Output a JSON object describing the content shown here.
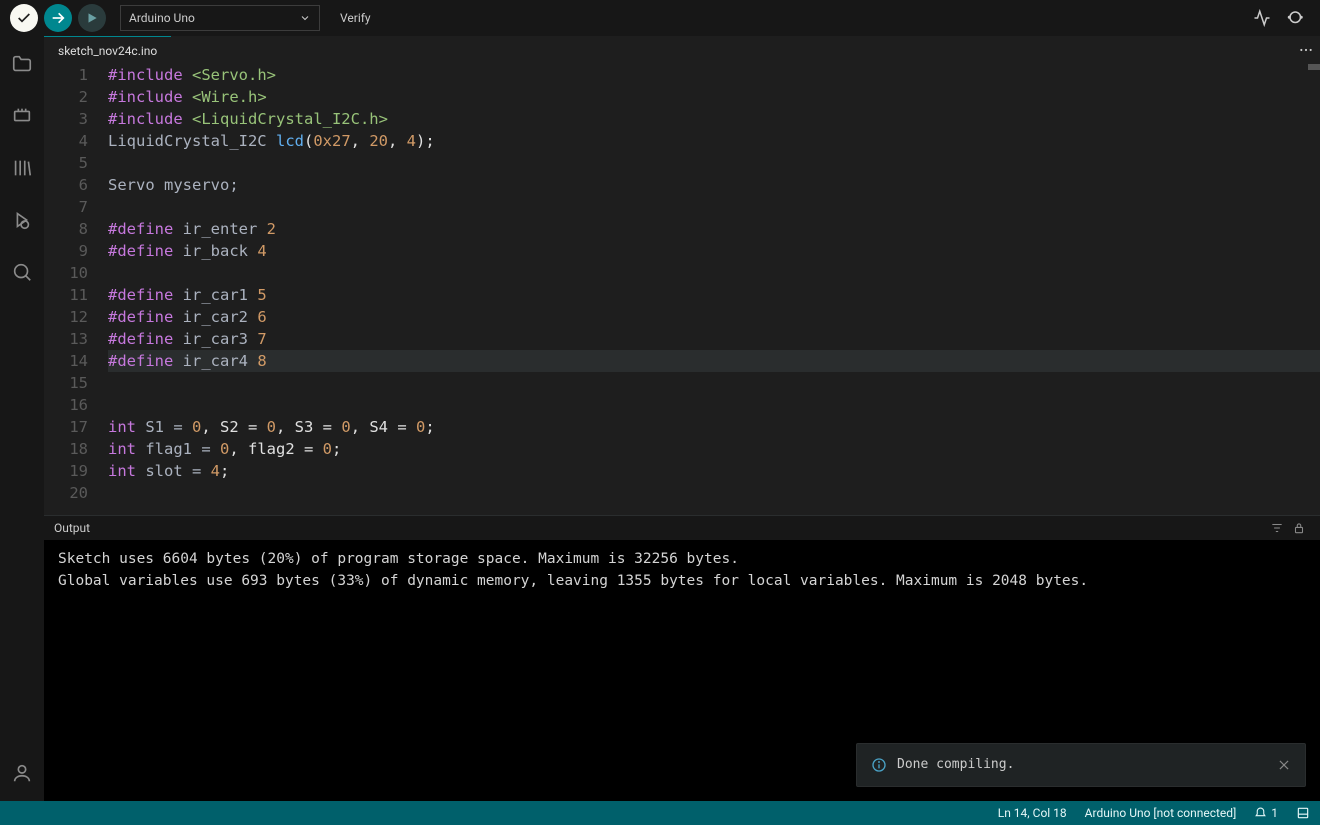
{
  "toolbar": {
    "board": "Arduino Uno",
    "verify_label": "Verify"
  },
  "sidebar": {
    "items": [
      {
        "name": "folder"
      },
      {
        "name": "board-manager"
      },
      {
        "name": "library-manager"
      },
      {
        "name": "debug"
      },
      {
        "name": "search"
      }
    ]
  },
  "tabs": {
    "active": "sketch_nov24c.ino"
  },
  "editor": {
    "highlight_line_index": 13,
    "lines": [
      {
        "n": 1,
        "t": [
          [
            "dir",
            "#include "
          ],
          [
            "str",
            "<Servo.h>"
          ]
        ]
      },
      {
        "n": 2,
        "t": [
          [
            "dir",
            "#include "
          ],
          [
            "str",
            "<Wire.h>"
          ]
        ]
      },
      {
        "n": 3,
        "t": [
          [
            "dir",
            "#include "
          ],
          [
            "str",
            "<LiquidCrystal_I2C.h>"
          ]
        ]
      },
      {
        "n": 4,
        "t": [
          [
            "id",
            "LiquidCrystal_I2C "
          ],
          [
            "fn",
            "lcd"
          ],
          [
            "plain",
            "("
          ],
          [
            "num",
            "0x27"
          ],
          [
            "plain",
            ", "
          ],
          [
            "num",
            "20"
          ],
          [
            "plain",
            ", "
          ],
          [
            "num",
            "4"
          ],
          [
            "plain",
            ");"
          ]
        ]
      },
      {
        "n": 5,
        "t": []
      },
      {
        "n": 6,
        "t": [
          [
            "id",
            "Servo myservo;"
          ]
        ]
      },
      {
        "n": 7,
        "t": []
      },
      {
        "n": 8,
        "t": [
          [
            "dir",
            "#define "
          ],
          [
            "id",
            "ir_enter "
          ],
          [
            "num",
            "2"
          ]
        ]
      },
      {
        "n": 9,
        "t": [
          [
            "dir",
            "#define "
          ],
          [
            "id",
            "ir_back "
          ],
          [
            "num",
            "4"
          ]
        ]
      },
      {
        "n": 10,
        "t": []
      },
      {
        "n": 11,
        "t": [
          [
            "dir",
            "#define "
          ],
          [
            "id",
            "ir_car1 "
          ],
          [
            "num",
            "5"
          ]
        ]
      },
      {
        "n": 12,
        "t": [
          [
            "dir",
            "#define "
          ],
          [
            "id",
            "ir_car2 "
          ],
          [
            "num",
            "6"
          ]
        ]
      },
      {
        "n": 13,
        "t": [
          [
            "dir",
            "#define "
          ],
          [
            "id",
            "ir_car3 "
          ],
          [
            "num",
            "7"
          ]
        ]
      },
      {
        "n": 14,
        "t": [
          [
            "dir",
            "#define "
          ],
          [
            "id",
            "ir_car4 "
          ],
          [
            "num",
            "8"
          ]
        ]
      },
      {
        "n": 15,
        "t": []
      },
      {
        "n": 16,
        "t": []
      },
      {
        "n": 17,
        "t": [
          [
            "type",
            "int "
          ],
          [
            "id",
            "S1 = "
          ],
          [
            "num",
            "0"
          ],
          [
            "plain",
            ", S2 = "
          ],
          [
            "num",
            "0"
          ],
          [
            "plain",
            ", S3 = "
          ],
          [
            "num",
            "0"
          ],
          [
            "plain",
            ", S4 = "
          ],
          [
            "num",
            "0"
          ],
          [
            "plain",
            ";"
          ]
        ]
      },
      {
        "n": 18,
        "t": [
          [
            "type",
            "int "
          ],
          [
            "id",
            "flag1 = "
          ],
          [
            "num",
            "0"
          ],
          [
            "plain",
            ", flag2 = "
          ],
          [
            "num",
            "0"
          ],
          [
            "plain",
            ";"
          ]
        ]
      },
      {
        "n": 19,
        "t": [
          [
            "type",
            "int "
          ],
          [
            "id",
            "slot = "
          ],
          [
            "num",
            "4"
          ],
          [
            "plain",
            ";"
          ]
        ]
      },
      {
        "n": 20,
        "t": []
      }
    ]
  },
  "output": {
    "title": "Output",
    "lines": [
      "Sketch uses 6604 bytes (20%) of program storage space. Maximum is 32256 bytes.",
      "Global variables use 693 bytes (33%) of dynamic memory, leaving 1355 bytes for local variables. Maximum is 2048 bytes."
    ],
    "toast": "Done compiling."
  },
  "statusbar": {
    "cursor": "Ln 14, Col 18",
    "board": "Arduino Uno [not connected]",
    "notifications": "1"
  }
}
